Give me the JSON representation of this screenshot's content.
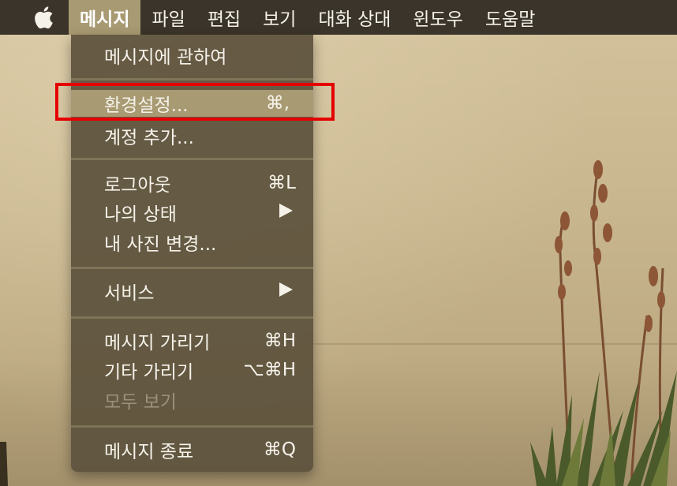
{
  "menubar": {
    "apple_icon": "apple-icon",
    "items": [
      {
        "label": "메시지",
        "active": true
      },
      {
        "label": "파일"
      },
      {
        "label": "편집"
      },
      {
        "label": "보기"
      },
      {
        "label": "대화 상대"
      },
      {
        "label": "윈도우"
      },
      {
        "label": "도움말"
      }
    ]
  },
  "dropdown": {
    "about": {
      "label": "메시지에 관하여"
    },
    "preferences": {
      "label": "환경설정...",
      "shortcut": "⌘,"
    },
    "add_account": {
      "label": "계정 추가..."
    },
    "logout": {
      "label": "로그아웃",
      "shortcut": "⌘L"
    },
    "my_status": {
      "label": "나의 상태",
      "icon": "submenu-arrow-icon"
    },
    "change_photo": {
      "label": "내 사진 변경..."
    },
    "services": {
      "label": "서비스",
      "icon": "submenu-arrow-icon"
    },
    "hide_messages": {
      "label": "메시지 가리기",
      "shortcut": "⌘H"
    },
    "hide_others": {
      "label": "기타 가리기",
      "shortcut": "⌥⌘H"
    },
    "show_all": {
      "label": "모두 보기",
      "disabled": true
    },
    "quit": {
      "label": "메시지 종료",
      "shortcut": "⌘Q"
    }
  },
  "colors": {
    "menubar_bg": "#3a342a",
    "menu_bg": "#5c523c",
    "highlight": "#a89a72",
    "annotation_box": "#e50000"
  }
}
